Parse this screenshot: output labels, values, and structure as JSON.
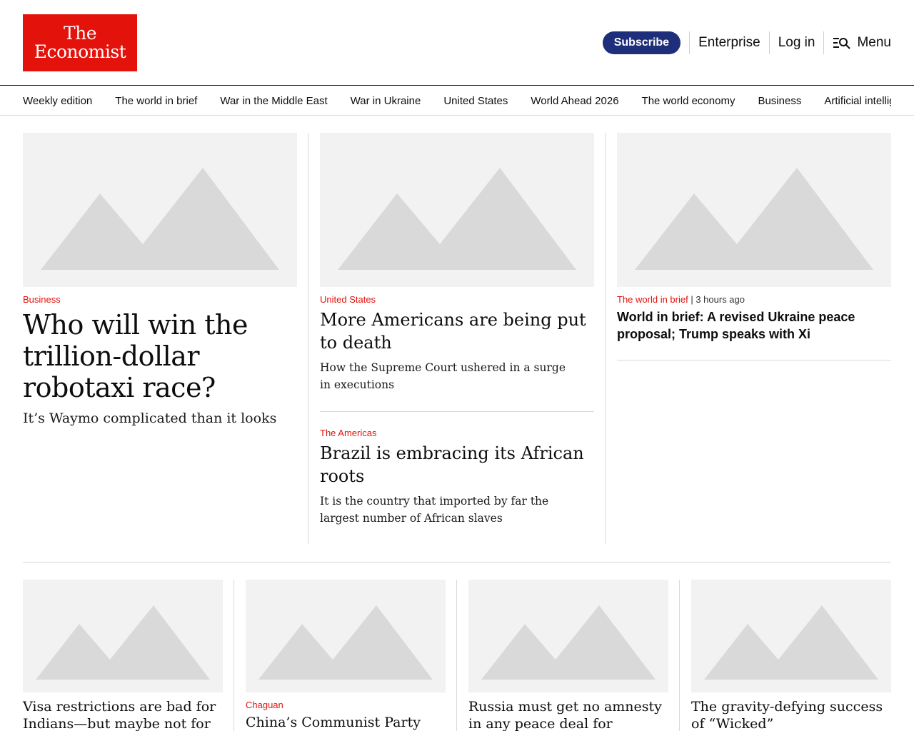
{
  "brand": {
    "line1": "The",
    "line2": "Economist",
    "color": "#e3120b"
  },
  "header": {
    "subscribe_label": "Subscribe",
    "enterprise_label": "Enterprise",
    "login_label": "Log in",
    "menu_label": "Menu",
    "subscribe_color": "#1f2e7a"
  },
  "nav": {
    "items": [
      "Weekly edition",
      "The world in brief",
      "War in the Middle East",
      "War in Ukraine",
      "United States",
      "World Ahead 2026",
      "The world economy",
      "Business",
      "Artificial intellig"
    ]
  },
  "top": {
    "lead": {
      "rubric": "Business",
      "headline": "Who will win the trillion-dollar robotaxi race?",
      "description": "It’s Waymo complicated than it looks"
    },
    "middle": [
      {
        "rubric": "United States",
        "headline": "More Americans are being put to death",
        "description": "How the Supreme Court ushered in a surge in executions"
      },
      {
        "rubric": "The Americas",
        "headline": "Brazil is embracing its African roots",
        "description": "It is the country that imported by far the largest number of African slaves"
      }
    ],
    "right": {
      "rubric": "The world in brief",
      "time": "3 hours ago",
      "headline": "World in brief: A revised Ukraine peace proposal; Trump speaks with Xi"
    }
  },
  "bottom": [
    {
      "rubric": "",
      "headline": "Visa restrictions are bad for Indians—but maybe not for"
    },
    {
      "rubric": "Chaguan",
      "headline": "China’s Communist Party wants"
    },
    {
      "rubric": "",
      "headline": "Russia must get no amnesty in any peace deal for Ukraine"
    },
    {
      "rubric": "",
      "headline": "The gravity-defying success of “Wicked”"
    }
  ]
}
